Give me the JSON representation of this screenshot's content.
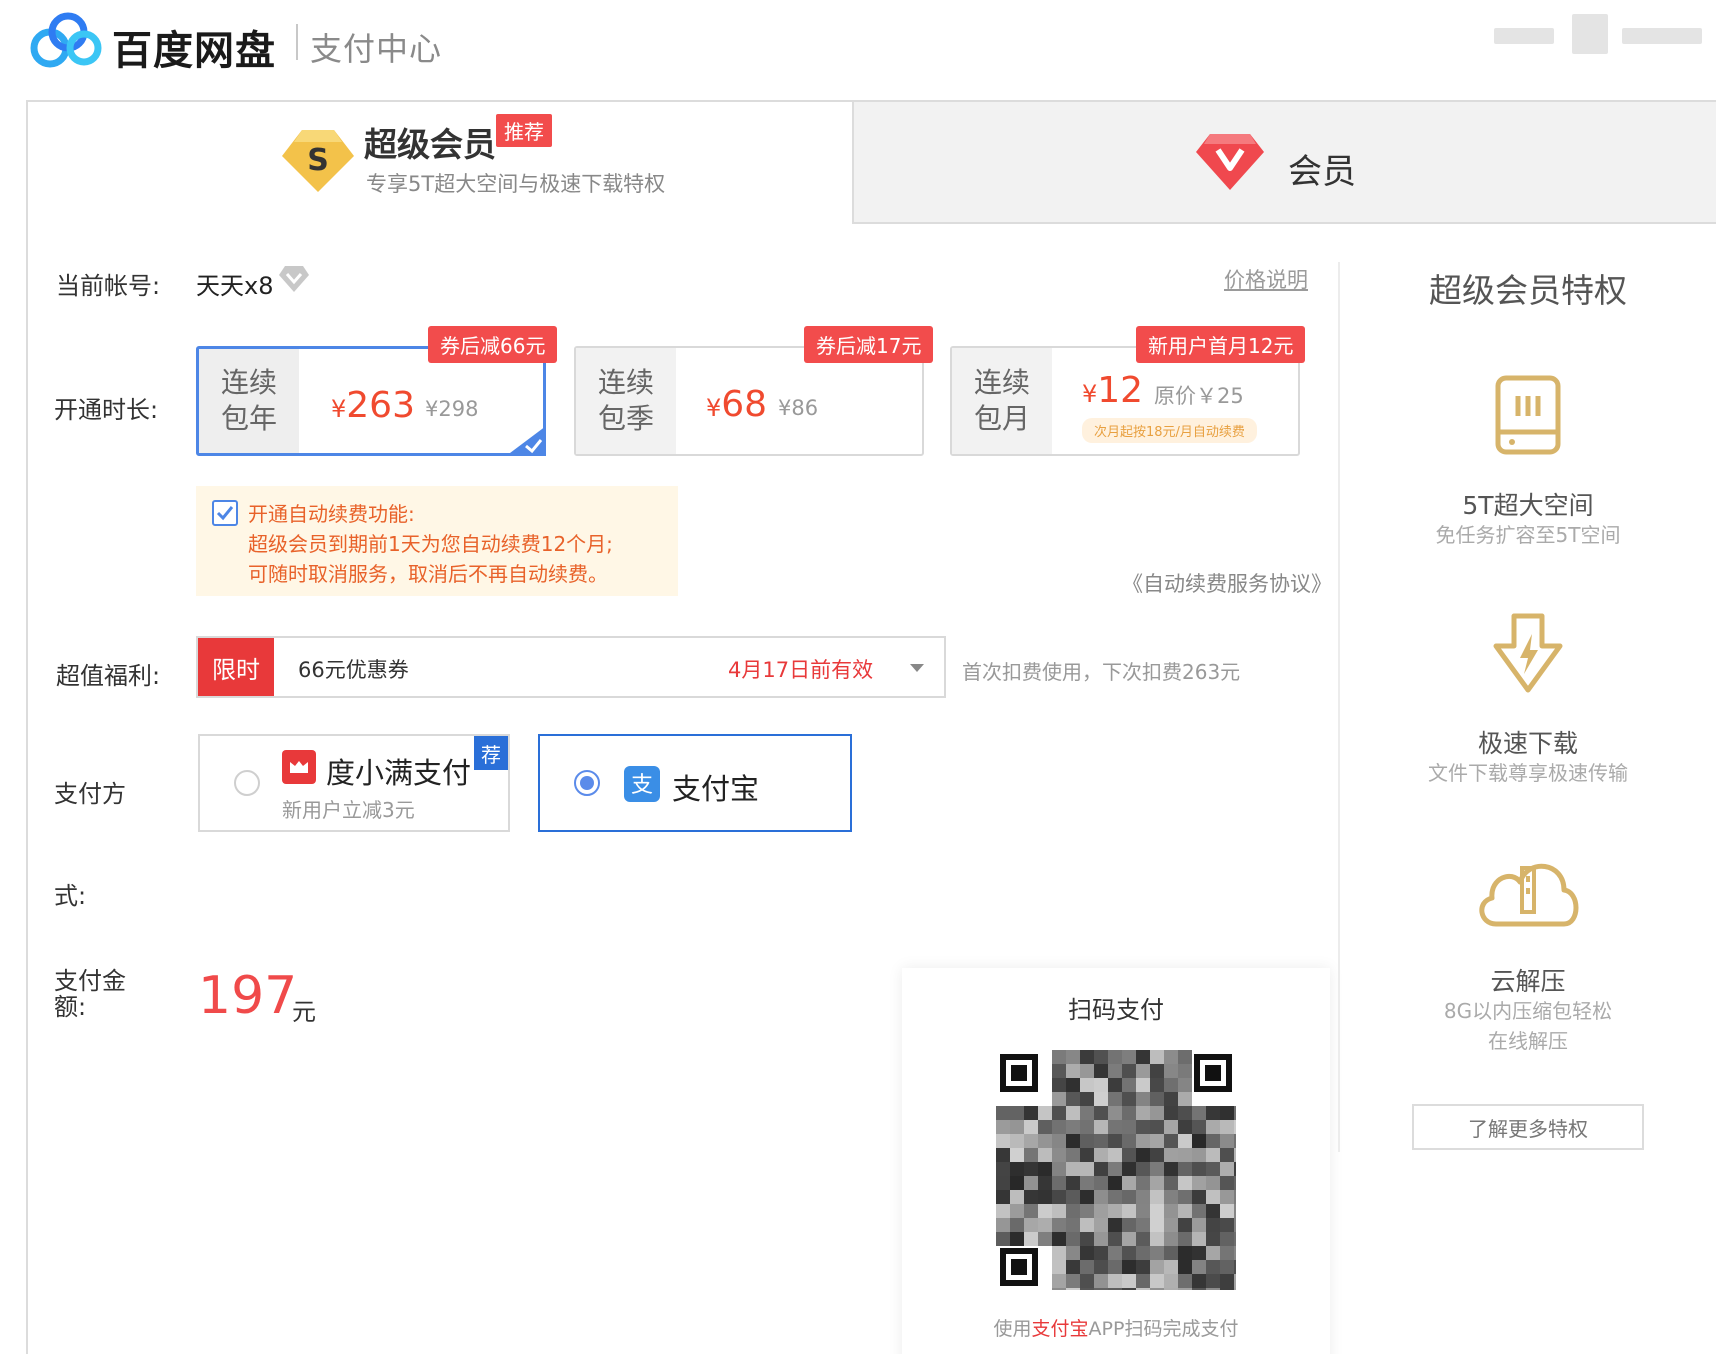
{
  "header": {
    "brand": "百度网盘",
    "subtitle": "支付中心"
  },
  "tabs": {
    "svip": {
      "title": "超级会员",
      "badge": "推荐",
      "subtitle": "专享5T超大空间与极速下载特权"
    },
    "vip": {
      "title": "会员"
    }
  },
  "account": {
    "label": "当前帐号:",
    "name": "天天x8",
    "price_link": "价格说明"
  },
  "duration": {
    "label": "开通时长:",
    "plans": [
      {
        "name_line1": "连续",
        "name_line2": "包年",
        "currency": "¥",
        "price": "263",
        "original": "¥298",
        "badge": "券后减66元",
        "selected": true
      },
      {
        "name_line1": "连续",
        "name_line2": "包季",
        "currency": "¥",
        "price": "68",
        "original": "¥86",
        "badge": "券后减17元",
        "selected": false
      },
      {
        "name_line1": "连续",
        "name_line2": "包月",
        "currency": "¥",
        "price": "12",
        "original": "原价￥25",
        "note": "次月起按18元/月自动续费",
        "badge": "新用户首月12元",
        "selected": false
      }
    ]
  },
  "auto_renew": {
    "checked": true,
    "line1": "开通自动续费功能:",
    "line2": "超级会员到期前1天为您自动续费12个月;",
    "line3": "可随时取消服务，取消后不再自动续费。",
    "agreement": "《自动续费服务协议》"
  },
  "benefit": {
    "label": "超值福利:",
    "tag": "限时",
    "coupon": "66元优惠券",
    "expire": "4月17日前有效",
    "note": "首次扣费使用，下次扣费263元"
  },
  "payment": {
    "label_line1": "支付方",
    "label_line2": "式:",
    "methods": [
      {
        "name": "度小满支付",
        "sub": "新用户立减3元",
        "badge": "荐",
        "selected": false
      },
      {
        "name": "支付宝",
        "selected": true
      }
    ]
  },
  "amount": {
    "label_line1": "支付金",
    "label_line2": "额:",
    "value": "197",
    "unit": "元"
  },
  "qr": {
    "title": "扫码支付",
    "hint_prefix": "使用",
    "hint_highlight": "支付宝",
    "hint_suffix": "APP扫码完成支付"
  },
  "sidebar": {
    "title": "超级会员特权",
    "features": [
      {
        "icon": "storage-icon",
        "title": "5T超大空间",
        "sub": "免任务扩容至5T空间"
      },
      {
        "icon": "fast-download-icon",
        "title": "极速下载",
        "sub": "文件下载尊享极速传输"
      },
      {
        "icon": "cloud-unzip-icon",
        "title": "云解压",
        "sub_line1": "8G以内压缩包轻松",
        "sub_line2": "在线解压"
      }
    ],
    "more_button": "了解更多特权"
  },
  "colors": {
    "accent_red": "#f04a2f",
    "accent_blue": "#4d86e6",
    "gold": "#d7b46a"
  }
}
